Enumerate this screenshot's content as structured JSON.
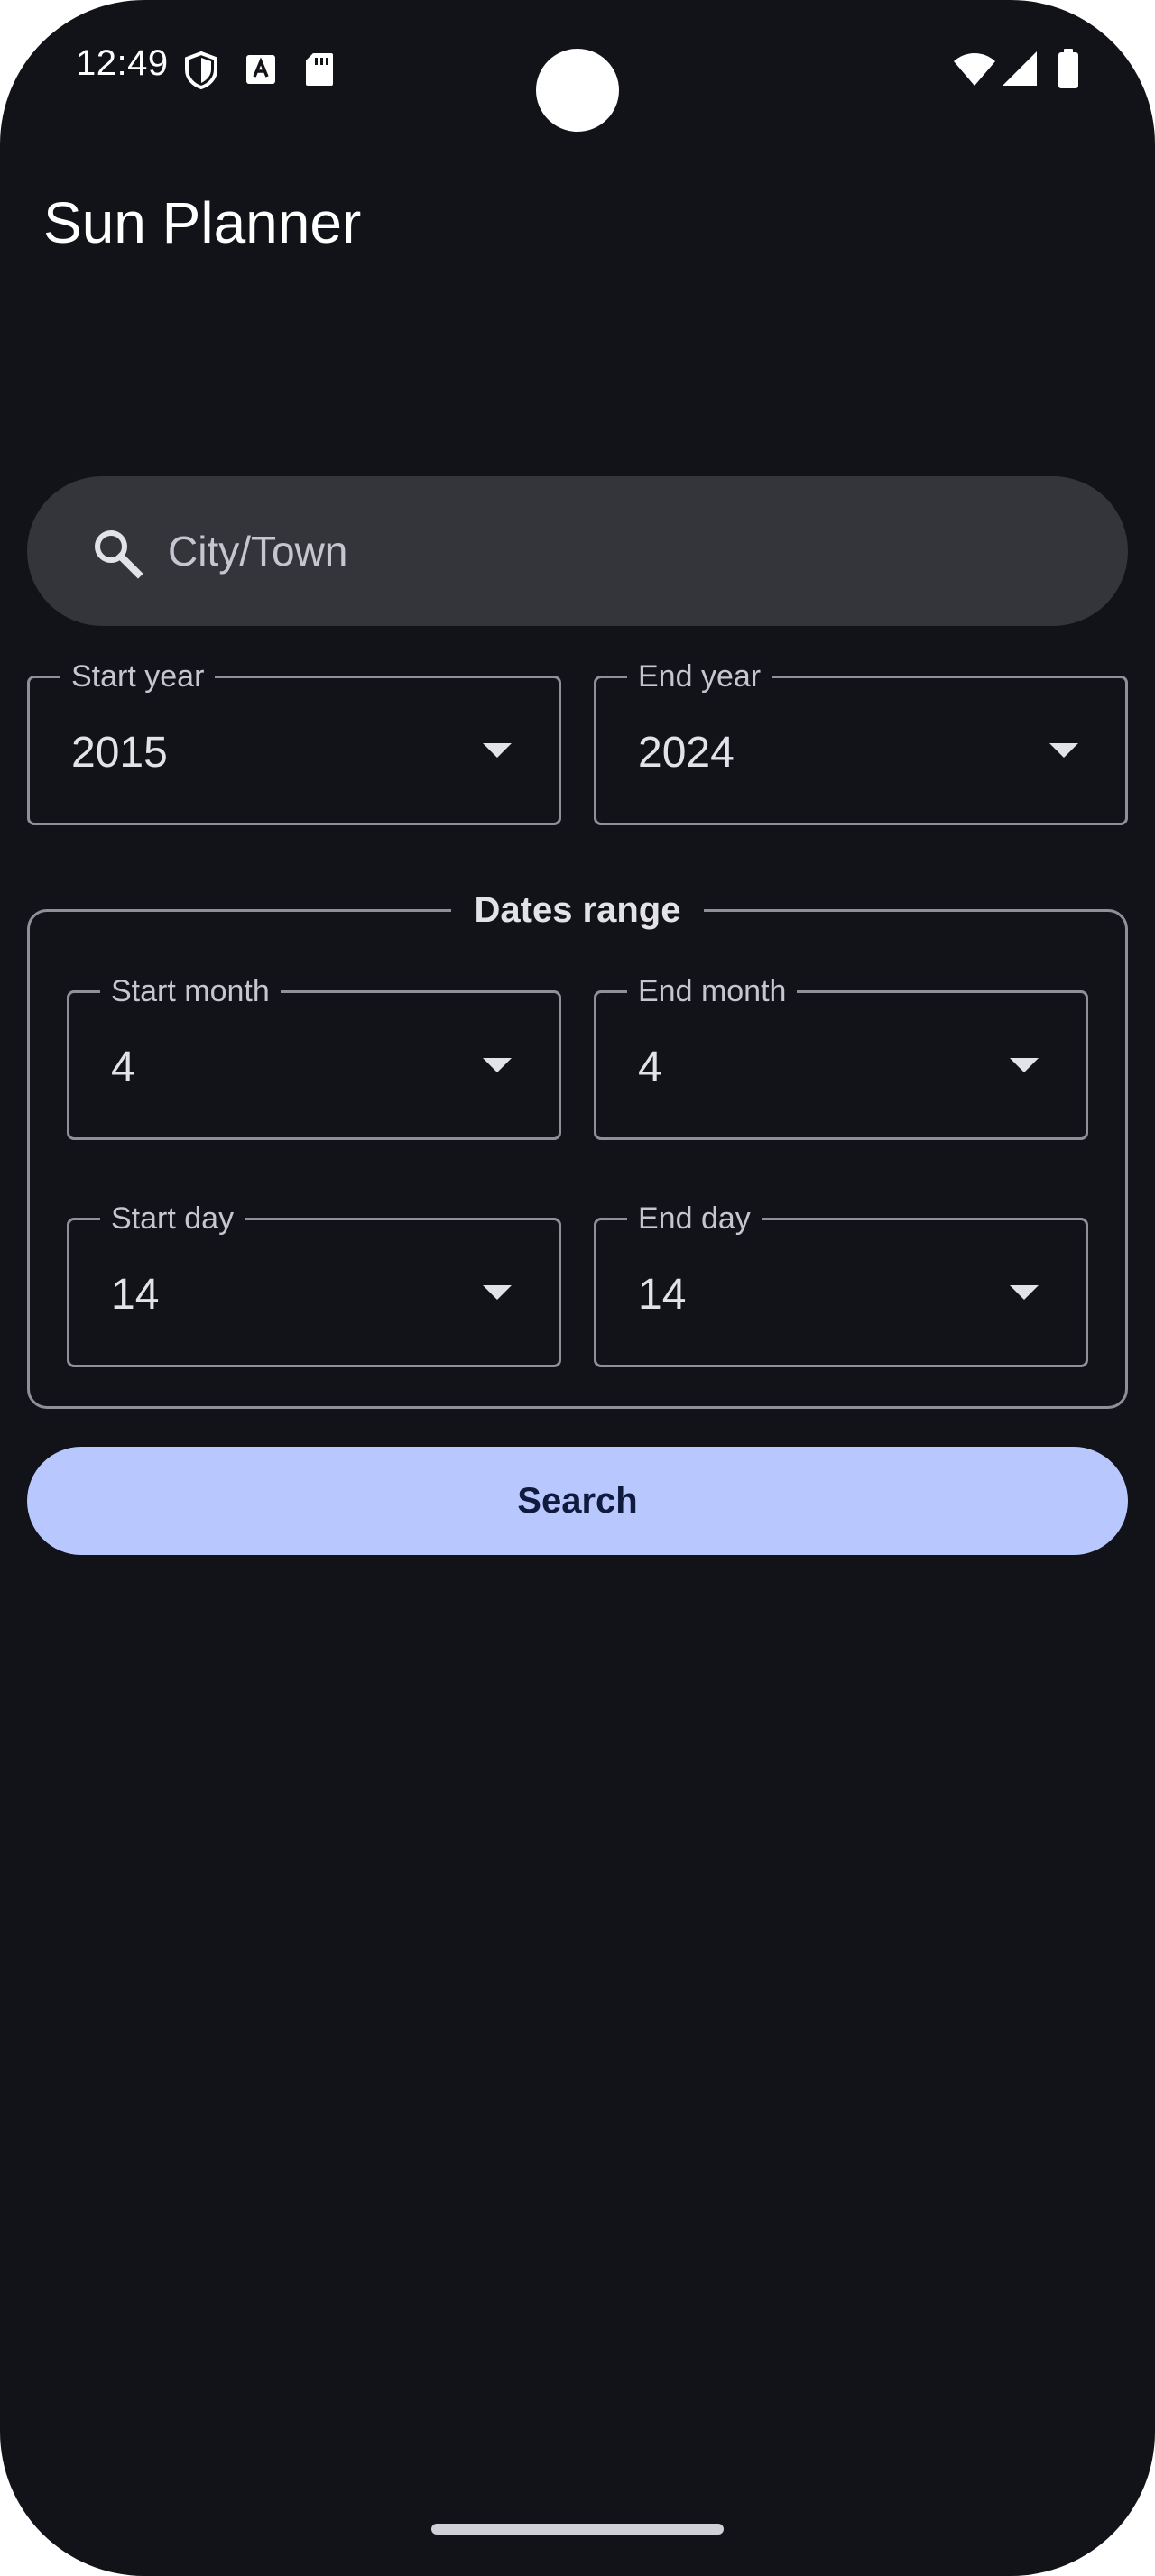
{
  "status_bar": {
    "time": "12:49",
    "icons_left": [
      "shield-icon",
      "font-a-icon",
      "sd-card-icon"
    ],
    "icons_right": [
      "wifi-icon",
      "cell-signal-icon",
      "battery-icon"
    ]
  },
  "app_bar": {
    "title": "Sun Planner"
  },
  "search": {
    "placeholder": "City/Town",
    "value": "",
    "icon": "search-icon"
  },
  "years": {
    "start": {
      "label": "Start year",
      "value": "2015"
    },
    "end": {
      "label": "End year",
      "value": "2024"
    }
  },
  "dates_range": {
    "title": "Dates range",
    "start_month": {
      "label": "Start month",
      "value": "4"
    },
    "end_month": {
      "label": "End month",
      "value": "4"
    },
    "start_day": {
      "label": "Start day",
      "value": "14"
    },
    "end_day": {
      "label": "End day",
      "value": "14"
    }
  },
  "search_button": {
    "label": "Search"
  },
  "colors": {
    "background": "#121318",
    "search_bar": "#34353b",
    "outline": "#8f909a",
    "primary_button": "#b8c8ff",
    "on_primary": "#0f1a3d"
  }
}
